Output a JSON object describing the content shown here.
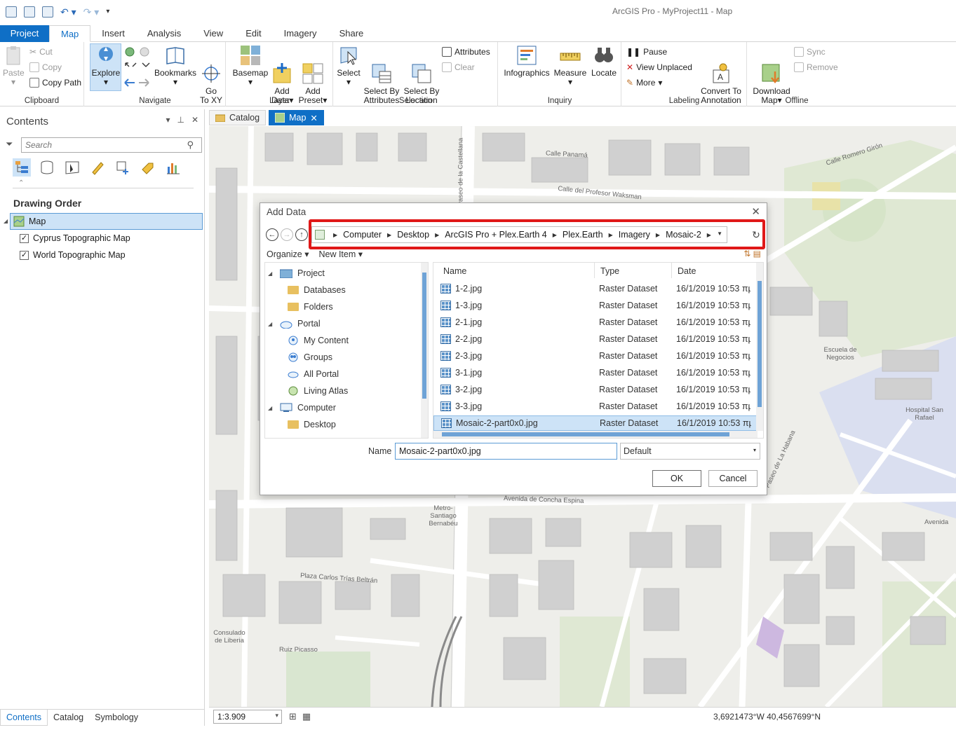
{
  "window": {
    "title": "ArcGIS Pro - MyProject11 - Map"
  },
  "ribbon_tabs": [
    "Project",
    "Map",
    "Insert",
    "Analysis",
    "View",
    "Edit",
    "Imagery",
    "Share"
  ],
  "ribbon": {
    "clipboard": {
      "label": "Clipboard",
      "paste": "Paste",
      "cut": "Cut",
      "copy": "Copy",
      "copy_path": "Copy Path"
    },
    "navigate": {
      "label": "Navigate",
      "explore": "Explore",
      "bookmarks": "Bookmarks",
      "go_to_xy": "Go\nTo XY"
    },
    "layer": {
      "label": "Layer",
      "basemap": "Basemap",
      "add_data": "Add\nData",
      "add_preset": "Add\nPreset"
    },
    "selection": {
      "label": "Selection",
      "select": "Select",
      "select_by_attributes": "Select By\nAttributes",
      "select_by_location": "Select By\nLocation",
      "attributes": "Attributes",
      "clear": "Clear"
    },
    "inquiry": {
      "label": "Inquiry",
      "infographics": "Infographics",
      "measure": "Measure",
      "locate": "Locate"
    },
    "labeling": {
      "label": "Labeling",
      "pause": "Pause",
      "view_unplaced": "View Unplaced",
      "more": "More",
      "convert_to_annotation": "Convert To\nAnnotation"
    },
    "offline": {
      "label": "Offline",
      "download_map": "Download\nMap",
      "sync": "Sync",
      "remove": "Remove"
    }
  },
  "contents": {
    "title": "Contents",
    "search_placeholder": "Search",
    "drawing_order": "Drawing Order",
    "map_item": "Map",
    "layers": [
      "Cyprus Topographic Map",
      "World Topographic Map"
    ],
    "bottom_tabs": [
      "Contents",
      "Catalog",
      "Symbology"
    ]
  },
  "doc_tabs": {
    "catalog": "Catalog",
    "map": "Map",
    "close": "✕"
  },
  "map_labels": {
    "calle_panama": "Calle Panamá",
    "calle_profesor": "Calle del Profesor Waksman",
    "ramero_giron": "Calle Romero Girón",
    "concha_espina": "Avenida de Concha Espina",
    "escuela": "Escuela de Negocios",
    "hospital": "Hospital San Rafael",
    "metro": "Metro- Santiago Bernabéu",
    "plaza": "Plaza Carlos Trías Beltrán",
    "ruiz_picasso": "Ruiz Picasso",
    "consulado": "Consulado de Liberia",
    "la_habana": "Paseo de La Habana",
    "castellana": "Paseo de la Castellana",
    "avenida": "Avenida"
  },
  "status": {
    "scale": "1:3.909",
    "coords": "3,6921473°W 40,4567699°N"
  },
  "dialog": {
    "title": "Add Data",
    "breadcrumb": [
      "Computer",
      "Desktop",
      "ArcGIS Pro + Plex.Earth 4",
      "Plex.Earth",
      "Imagery",
      "Mosaic-2"
    ],
    "organize": "Organize ▾",
    "new_item": "New Item ▾",
    "nav_tree": [
      {
        "label": "Project",
        "level": 0,
        "expanded": true
      },
      {
        "label": "Databases",
        "level": 1
      },
      {
        "label": "Folders",
        "level": 1
      },
      {
        "label": "Portal",
        "level": 0,
        "expanded": true
      },
      {
        "label": "My Content",
        "level": 1
      },
      {
        "label": "Groups",
        "level": 1
      },
      {
        "label": "All Portal",
        "level": 1
      },
      {
        "label": "Living Atlas",
        "level": 1
      },
      {
        "label": "Computer",
        "level": 0,
        "expanded": true
      },
      {
        "label": "Desktop",
        "level": 1
      }
    ],
    "columns": [
      "Name",
      "Type",
      "Date"
    ],
    "files": [
      {
        "name": "1-2.jpg",
        "type": "Raster Dataset",
        "date": "16/1/2019 10:53 πμ"
      },
      {
        "name": "1-3.jpg",
        "type": "Raster Dataset",
        "date": "16/1/2019 10:53 πμ"
      },
      {
        "name": "2-1.jpg",
        "type": "Raster Dataset",
        "date": "16/1/2019 10:53 πμ"
      },
      {
        "name": "2-2.jpg",
        "type": "Raster Dataset",
        "date": "16/1/2019 10:53 πμ"
      },
      {
        "name": "2-3.jpg",
        "type": "Raster Dataset",
        "date": "16/1/2019 10:53 πμ"
      },
      {
        "name": "3-1.jpg",
        "type": "Raster Dataset",
        "date": "16/1/2019 10:53 πμ"
      },
      {
        "name": "3-2.jpg",
        "type": "Raster Dataset",
        "date": "16/1/2019 10:53 πμ"
      },
      {
        "name": "3-3.jpg",
        "type": "Raster Dataset",
        "date": "16/1/2019 10:53 πμ"
      },
      {
        "name": "Mosaic-2-part0x0.jpg",
        "type": "Raster Dataset",
        "date": "16/1/2019 10:53 πμ",
        "selected": true
      }
    ],
    "name_label": "Name",
    "name_value": "Mosaic-2-part0x0.jpg",
    "filter_value": "Default",
    "ok": "OK",
    "cancel": "Cancel",
    "highlight_color": "#e01818"
  },
  "colors": {
    "accent": "#0f6fc6",
    "selection": "#cde3f7"
  }
}
